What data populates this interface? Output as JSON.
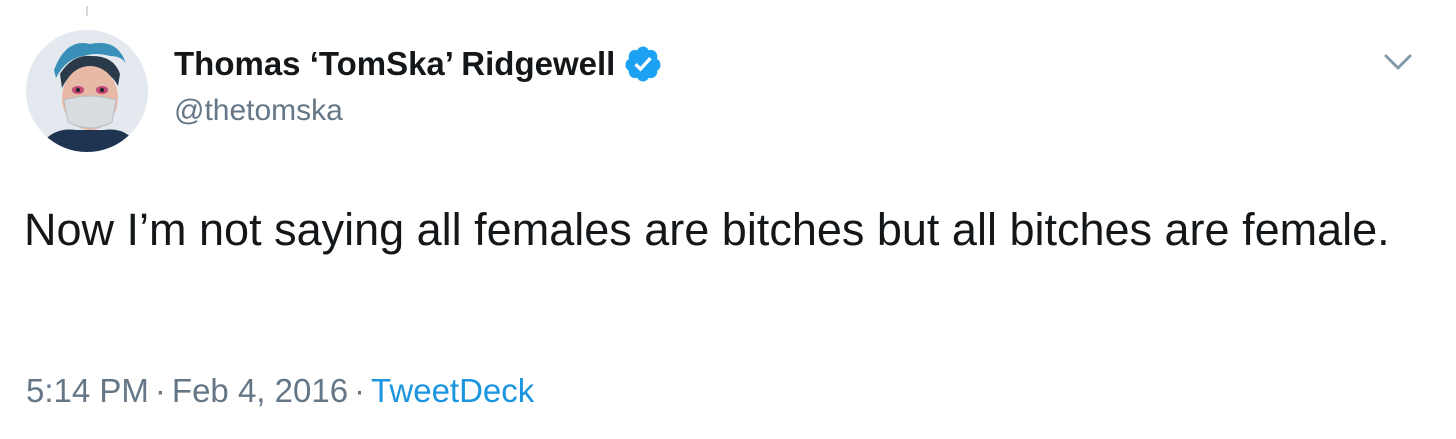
{
  "tweet": {
    "author": {
      "display_name": "Thomas ‘TomSka’ Ridgewell",
      "handle": "@thetomska",
      "verified": true,
      "avatar_icon": "profile-avatar"
    },
    "text": "Now I’m not saying all females are bitches but all bitches are female.",
    "time": "5:14 PM",
    "date": "Feb 4, 2016",
    "separator": "·",
    "source": "TweetDeck",
    "menu_icon": "chevron-down-icon"
  },
  "colors": {
    "text_primary": "#14171a",
    "text_secondary": "#657786",
    "link": "#1b95e0",
    "verified_badge": "#1da1f2"
  }
}
